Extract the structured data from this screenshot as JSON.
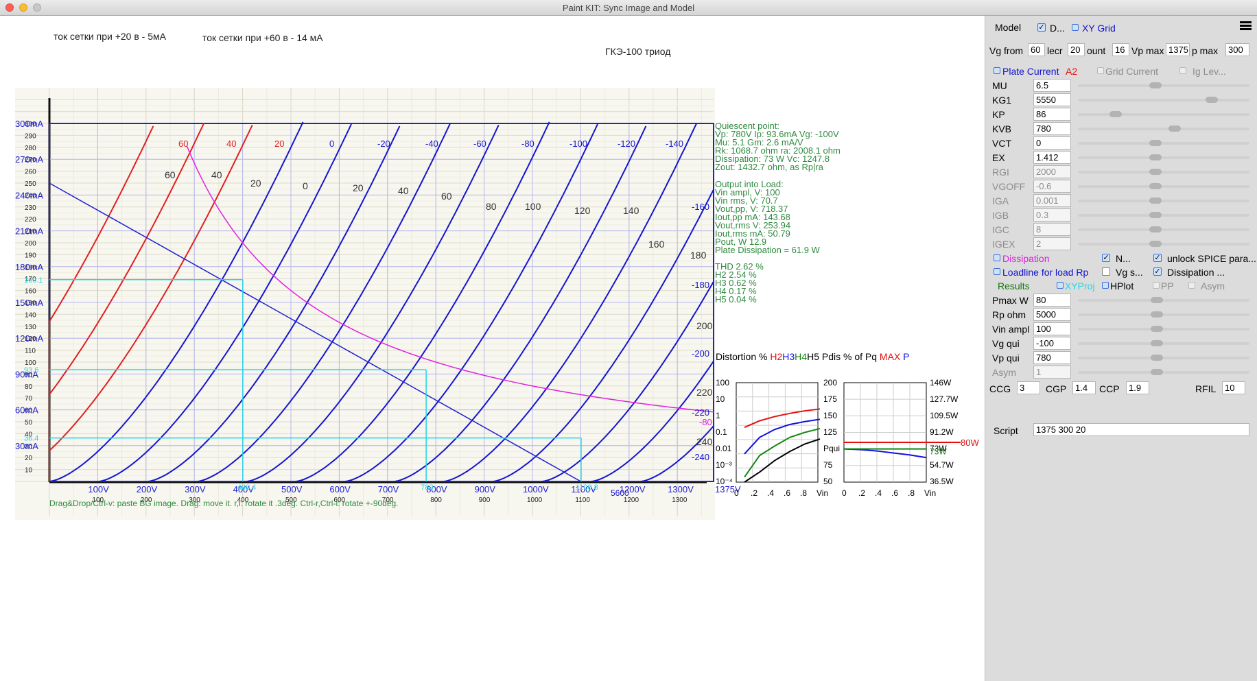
{
  "window": {
    "title": "Paint KIT: Sync Image and Model"
  },
  "bg_image": {
    "note1": "ток сетки при +20 в - 5мА",
    "note2": "ток сетки при +60 в - 14 мА",
    "tube": "ГКЭ-100  триод",
    "y_ticks": [
      "300",
      "290",
      "280",
      "270",
      "260",
      "250",
      "240",
      "230",
      "220",
      "210",
      "200",
      "190",
      "180",
      "170",
      "160",
      "150",
      "140",
      "130",
      "120",
      "110",
      "100",
      "90",
      "80",
      "70",
      "60",
      "50",
      "40",
      "30",
      "20",
      "10"
    ],
    "x_ticks": [
      "100",
      "200",
      "300",
      "400",
      "500",
      "600",
      "700",
      "800",
      "900",
      "1000",
      "1100",
      "1200",
      "1300"
    ],
    "curve_labels": [
      "60",
      "40",
      "20",
      "0",
      "20",
      "40",
      "60",
      "80",
      "100",
      "120",
      "140",
      "160",
      "180",
      "200",
      "220",
      "240"
    ]
  },
  "plot": {
    "y_labels": [
      "300mA",
      "270mA",
      "240mA",
      "210mA",
      "180mA",
      "150mA",
      "120mA",
      "90mA",
      "60mA",
      "30mA"
    ],
    "x_labels": [
      "100V",
      "200V",
      "300V",
      "400V",
      "500V",
      "600V",
      "700V",
      "800V",
      "900V",
      "1000V",
      "1100V",
      "1200V",
      "1300V",
      "1375V"
    ],
    "top_labels_red": [
      "60",
      "40",
      "20"
    ],
    "top_labels_blue": [
      "0",
      "-20",
      "-40",
      "-60",
      "-80",
      "-100",
      "-120",
      "-140"
    ],
    "right_labels_blue": [
      "-160",
      "-180",
      "-200",
      "-220",
      "-240"
    ],
    "right_label_magenta": "-80",
    "marker_y": [
      "169.1",
      "93.6",
      "36.4"
    ],
    "marker_x": [
      "400.4",
      "780",
      "1100.8"
    ],
    "note_5600": "5600",
    "hint": "Drag&Drop/Ctrl-v: paste BG image. Drag: move it. r,l: rotate it .3deg. Ctrl-r,Ctrl-l: rotate +-90deg."
  },
  "chart_data": [
    {
      "type": "line",
      "title": "",
      "xlabel": "",
      "ylabel": "",
      "x_unit": "V",
      "y_unit": "mA",
      "xlim": [
        0,
        1375
      ],
      "ylim": [
        0,
        300
      ],
      "series_grid_voltages": [
        60,
        40,
        20,
        0,
        -20,
        -40,
        -60,
        -80,
        -100,
        -120,
        -140,
        -160,
        -180,
        -200,
        -220,
        -240
      ],
      "loadline": {
        "x": [
          0,
          1100
        ],
        "y": [
          250,
          0
        ]
      },
      "dissipation_curve_W": 80,
      "quiescent_point": {
        "vp": 780,
        "ip": 93.6
      }
    },
    {
      "type": "line",
      "title": "Distortion % H2H3H4H5",
      "x": [
        0,
        0.2,
        0.4,
        0.6,
        0.8,
        1.0
      ],
      "ylim": [
        "1e-4",
        100
      ],
      "yscale": "log",
      "series": [
        {
          "name": "H2",
          "values": [
            0.2,
            0.5,
            0.9,
            1.4,
            2.0,
            2.6
          ]
        },
        {
          "name": "H3",
          "values": [
            0.005,
            0.05,
            0.15,
            0.3,
            0.45,
            0.62
          ]
        },
        {
          "name": "H4",
          "values": [
            0.0002,
            0.004,
            0.015,
            0.05,
            0.1,
            0.17
          ]
        },
        {
          "name": "H5",
          "values": [
            1e-05,
            0.0004,
            0.002,
            0.007,
            0.02,
            0.04
          ]
        }
      ]
    },
    {
      "type": "line",
      "title": "Pdis % of Pq MAX P",
      "x": [
        0,
        0.2,
        0.4,
        0.6,
        0.8,
        1.0
      ],
      "ylim": [
        50,
        200
      ],
      "y_ticks": [
        50,
        75,
        100,
        125,
        150,
        175,
        200
      ],
      "y_ticks_right": [
        "36.5W",
        "54.7W",
        "73W",
        "91.2W",
        "109.5W",
        "127.7W",
        "146W"
      ],
      "series": [
        {
          "name": "MAX",
          "values": [
            110,
            110,
            110,
            110,
            110,
            110
          ]
        },
        {
          "name": "P",
          "values": [
            100,
            99,
            97,
            94,
            91,
            87
          ]
        },
        {
          "name": "",
          "values": [
            100,
            100,
            100,
            100,
            100,
            100
          ]
        }
      ],
      "marker_right_red": "80W",
      "marker_right_green": "73W",
      "ylabel_mid": "Pqui"
    }
  ],
  "overlay": {
    "quiescent": [
      "Quiescent point:",
      "Vp: 780V  Ip: 93.6mA  Vg: -100V",
      "Mu: 5.1 Gm: 2.6 mA/V",
      "Rk: 1068.7 ohm ra: 2008.1 ohm",
      "Dissipation: 73 W Vc: 1247.8",
      "Zout: 1432.7 ohm, as Rp|ra"
    ],
    "output": [
      "Output into Load:",
      "Vin ampl, V: 100",
      "Vin rms, V: 70.7",
      "Vout,pp,   V: 718.37",
      "Iout,pp   mA: 143.68",
      "Vout,rms   V: 253.94",
      "Iout,rms  mA: 50.79",
      "Pout, W      12.9",
      "Plate Dissipation = 61.9 W"
    ],
    "thd": [
      "THD 2.62 %",
      "H2 2.54 %",
      "H3 0.62 %",
      "H4 0.17 %",
      "H5 0.04 %"
    ]
  },
  "dist_chart": {
    "title": "Distortion %",
    "h2": "H2",
    "h3": "H3",
    "h4": "H4",
    "h5": "H5",
    "yticks": [
      "100",
      "10",
      "1",
      "0.1",
      "0.01",
      "10⁻³",
      "10⁻⁴"
    ],
    "xticks": [
      "0",
      ".2",
      ".4",
      ".6",
      ".8",
      "Vin"
    ]
  },
  "pdis_chart": {
    "title": "Pdis % of Pq",
    "max": "MAX",
    "p": "P",
    "yticks": [
      "200",
      "175",
      "150",
      "125",
      "Pqui",
      "75",
      "50"
    ],
    "rticks": [
      "146W",
      "127.7W",
      "109.5W",
      "91.2W",
      "73W",
      "54.7W",
      "36.5W"
    ],
    "xticks": [
      "0",
      ".2",
      ".4",
      ".6",
      ".8",
      "Vin"
    ],
    "red_mark": "80W",
    "green_mark": "73W"
  },
  "panel": {
    "model_label": "Model",
    "d_label": "D...",
    "xygrid_label": "XY Grid",
    "vgfrom_label": "Vg from",
    "vgfrom": "60",
    "lecr_label": "lecr",
    "lecr": "20",
    "count_label": "ount",
    "count": "16",
    "vpmax_label": "Vp max",
    "vpmax": "1375",
    "pmax_label": "p max",
    "pmax": "300",
    "plate_current": "Plate Current",
    "a2": "A2",
    "grid_current": "Grid Current",
    "ig_lev": "Ig Lev...",
    "params": [
      {
        "name": "MU",
        "value": "6.5",
        "enabled": true,
        "knob": 0.45
      },
      {
        "name": "KG1",
        "value": "5550",
        "enabled": true,
        "knob": 0.8
      },
      {
        "name": "KP",
        "value": "86",
        "enabled": true,
        "knob": 0.2
      },
      {
        "name": "KVB",
        "value": "780",
        "enabled": true,
        "knob": 0.57
      },
      {
        "name": "VCT",
        "value": "0",
        "enabled": true,
        "knob": 0.45
      },
      {
        "name": "EX",
        "value": "1.412",
        "enabled": true,
        "knob": 0.45
      },
      {
        "name": "RGI",
        "value": "2000",
        "enabled": false,
        "knob": 0.45
      },
      {
        "name": "VGOFF",
        "value": "-0.6",
        "enabled": false,
        "knob": 0.45
      },
      {
        "name": "IGA",
        "value": "0.001",
        "enabled": false,
        "knob": 0.45
      },
      {
        "name": "IGB",
        "value": "0.3",
        "enabled": false,
        "knob": 0.45
      },
      {
        "name": "IGC",
        "value": "8",
        "enabled": false,
        "knob": 0.45
      },
      {
        "name": "IGEX",
        "value": "2",
        "enabled": false,
        "knob": 0.45
      }
    ],
    "dissipation": "Dissipation",
    "n_label": "N...",
    "unlock": "unlock SPICE para...",
    "loadline": "Loadline for load Rp",
    "vgs_label": "Vg s...",
    "dissipation2": "Dissipation ...",
    "results": "Results",
    "xyproj": "XYProj",
    "hplot": "HPlot",
    "pp": "PP",
    "asym": "Asym",
    "params2": [
      {
        "name": "Pmax W",
        "value": "80",
        "enabled": true
      },
      {
        "name": "Rp ohm",
        "value": "5000",
        "enabled": true
      },
      {
        "name": "Vin ampl",
        "value": "100",
        "enabled": true
      },
      {
        "name": "Vg qui",
        "value": "-100",
        "enabled": true
      },
      {
        "name": "Vp qui",
        "value": "780",
        "enabled": true
      },
      {
        "name": "Asym",
        "value": "1",
        "enabled": false
      }
    ],
    "ccg_label": "CCG",
    "ccg": "3",
    "cgp_label": "CGP",
    "cgp": "1.4",
    "ccp_label": "CCP",
    "ccp": "1.9",
    "rfil_label": "RFIL",
    "rfil": "10",
    "script_label": "Script",
    "script": "1375 300 20"
  }
}
